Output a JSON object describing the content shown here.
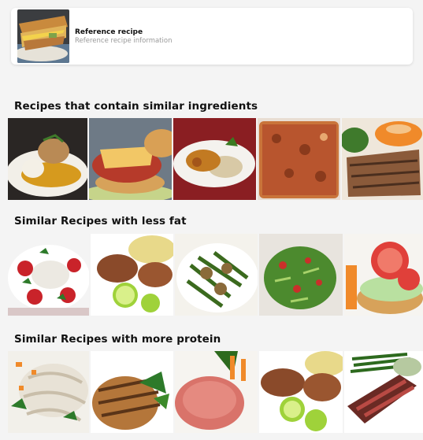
{
  "reference": {
    "title": "Reference recipe",
    "subtitle": "Reference recipe information",
    "image": "grilled-sandwich-image"
  },
  "sections": [
    {
      "title": "Recipes that contain similar ingredients",
      "images": [
        "chicken-mashed-potato-image",
        "chicken-parmesan-sandwich-image",
        "chicken-rice-herbs-image",
        "pizza-slice-image",
        "grilled-salmon-sweet-potato-image"
      ]
    },
    {
      "title": "Similar Recipes with less fat",
      "images": [
        "caprese-salad-image",
        "grilled-chicken-lime-couscous-image",
        "green-beans-mushroom-rice-image",
        "herb-salad-bowl-image",
        "open-bagel-tomato-image"
      ]
    },
    {
      "title": "Similar Recipes with more protein",
      "images": [
        "sliced-turkey-carrots-image",
        "grilled-chicken-basil-image",
        "ham-slice-vegetables-image",
        "grilled-chicken-lime-image",
        "sliced-steak-green-beans-image"
      ]
    }
  ]
}
